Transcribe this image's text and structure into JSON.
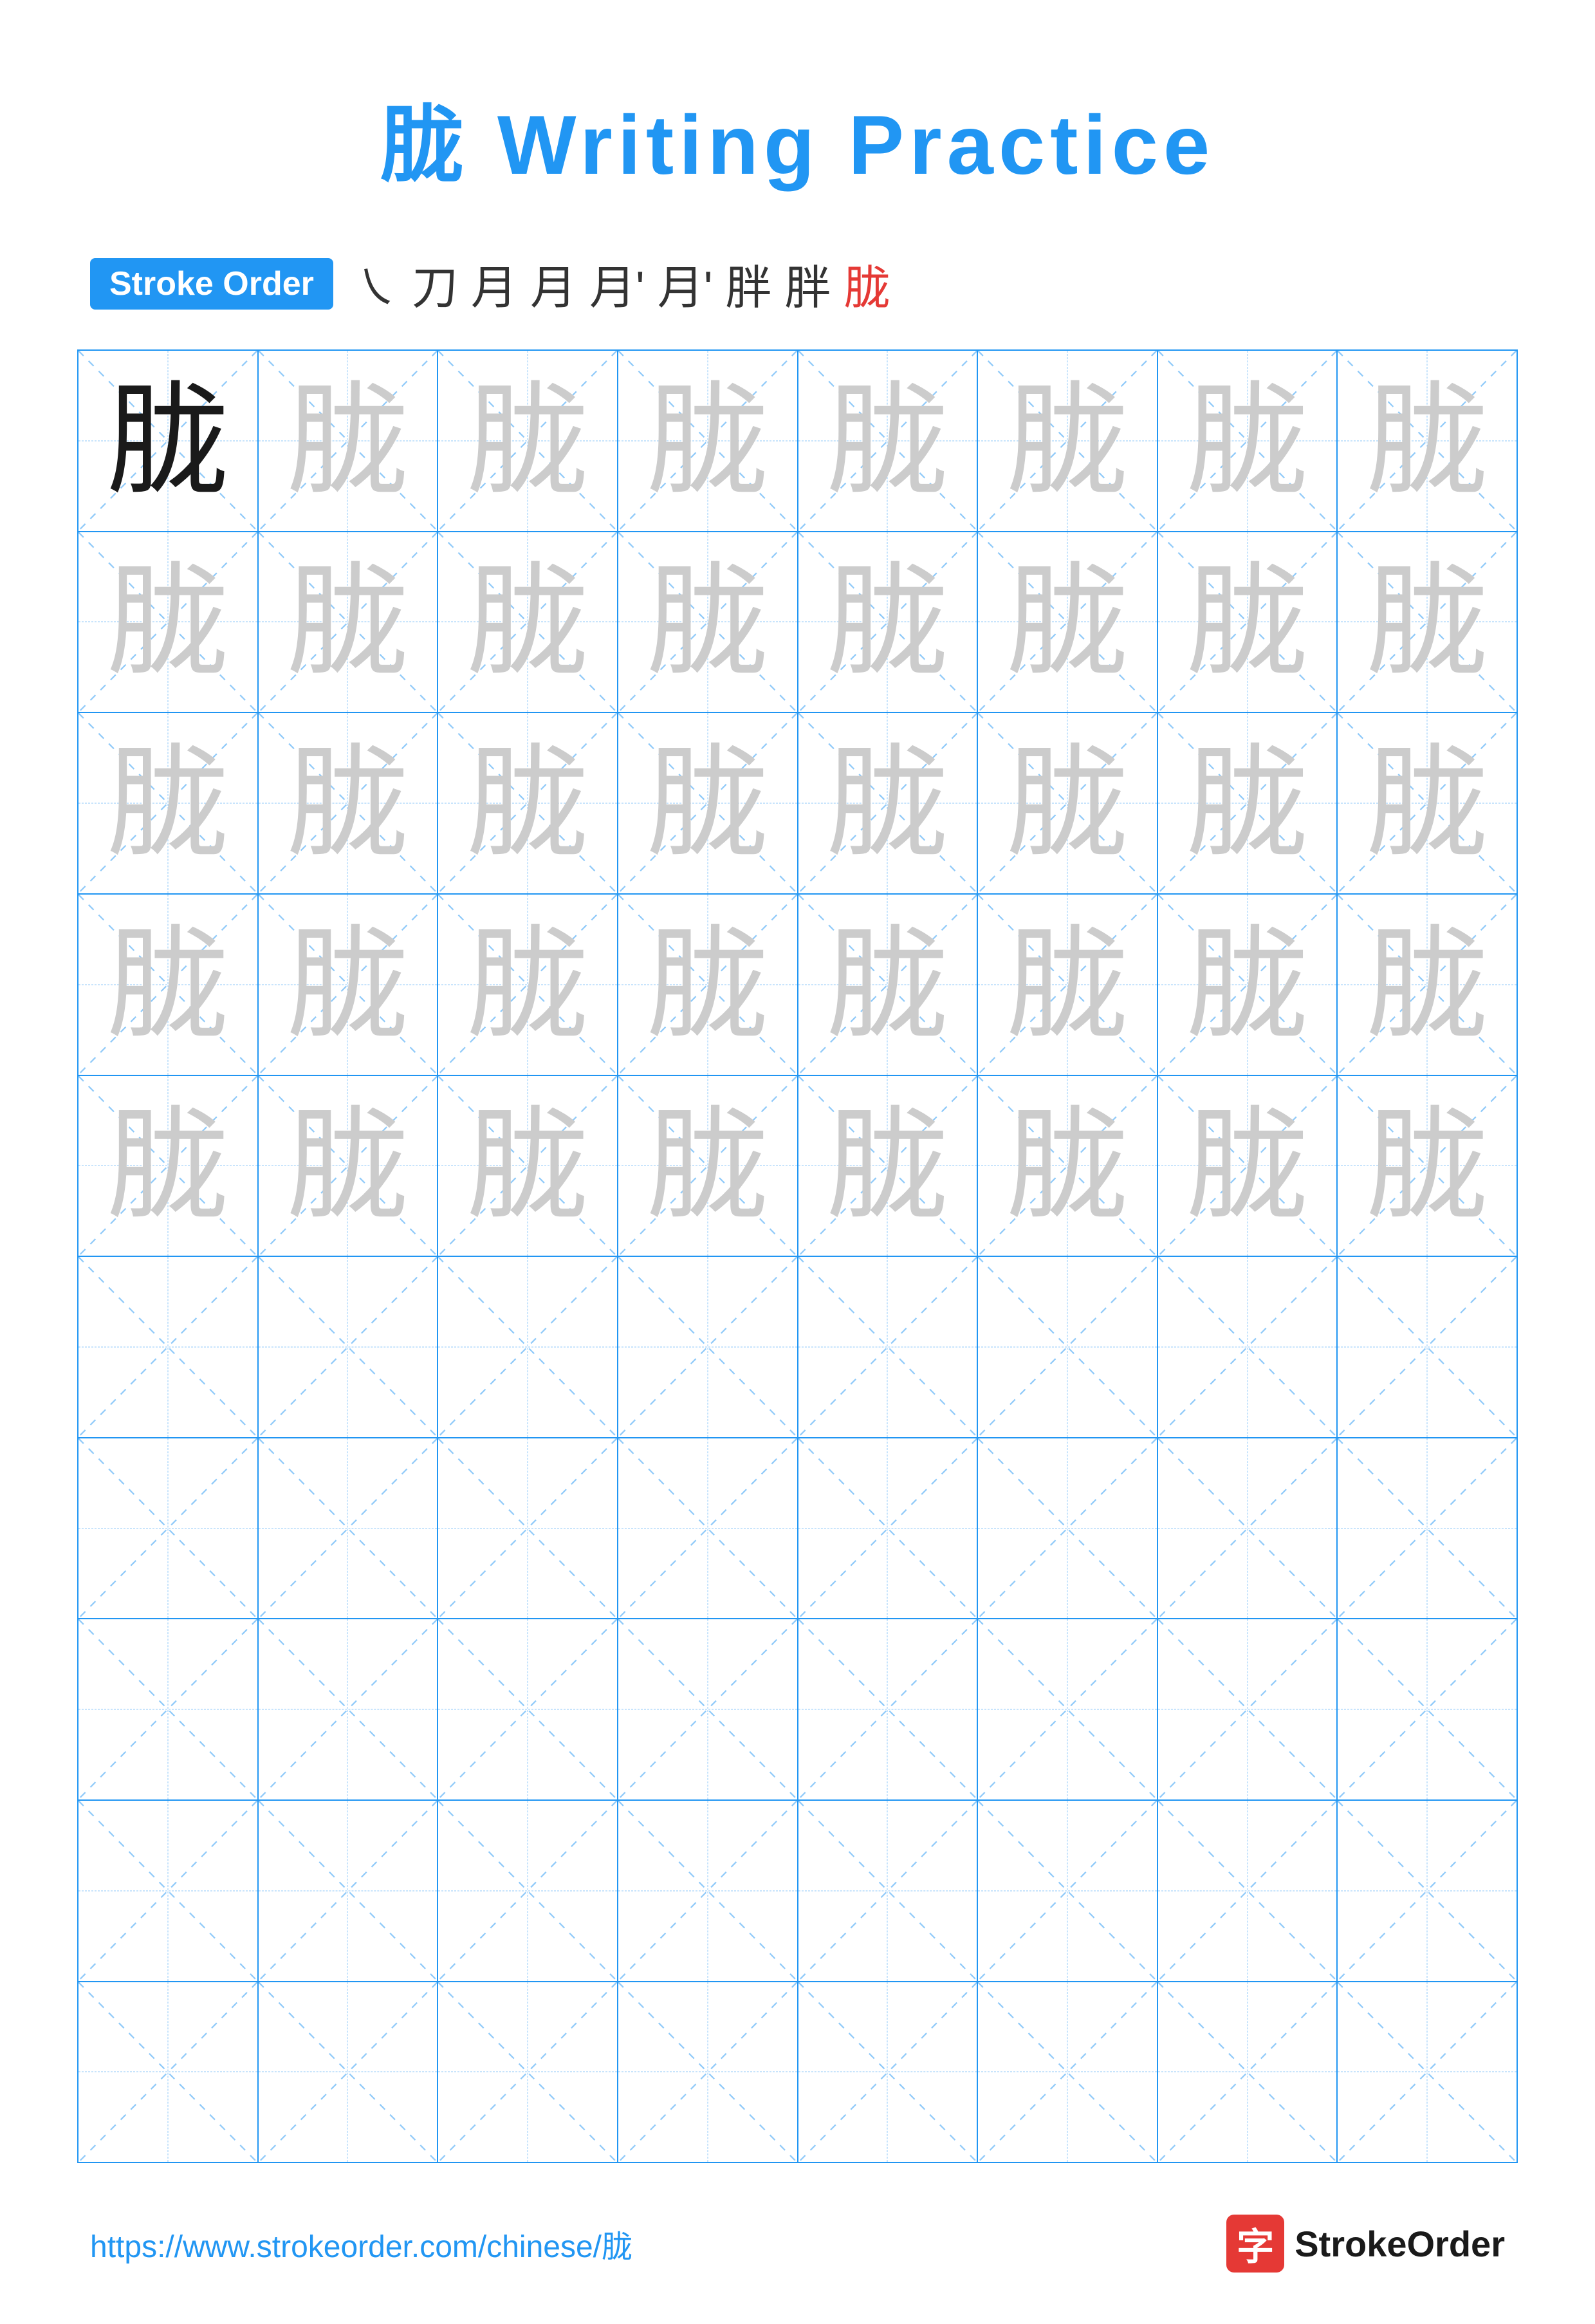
{
  "title": "胧 Writing Practice",
  "stroke_order_badge": "Stroke Order",
  "stroke_sequence": [
    "㇏",
    "刀",
    "月",
    "月",
    "月'",
    "月'",
    "胖",
    "胖",
    "胧"
  ],
  "stroke_sequence_last_red": true,
  "character": "胧",
  "rows": [
    {
      "type": "practice",
      "cells": [
        {
          "opacity": "dark"
        },
        {
          "opacity": "light"
        },
        {
          "opacity": "light"
        },
        {
          "opacity": "light"
        },
        {
          "opacity": "light"
        },
        {
          "opacity": "light"
        },
        {
          "opacity": "light"
        },
        {
          "opacity": "light"
        }
      ]
    },
    {
      "type": "practice",
      "cells": [
        {
          "opacity": "light"
        },
        {
          "opacity": "light"
        },
        {
          "opacity": "light"
        },
        {
          "opacity": "light"
        },
        {
          "opacity": "light"
        },
        {
          "opacity": "light"
        },
        {
          "opacity": "light"
        },
        {
          "opacity": "light"
        }
      ]
    },
    {
      "type": "practice",
      "cells": [
        {
          "opacity": "light"
        },
        {
          "opacity": "light"
        },
        {
          "opacity": "light"
        },
        {
          "opacity": "light"
        },
        {
          "opacity": "light"
        },
        {
          "opacity": "light"
        },
        {
          "opacity": "light"
        },
        {
          "opacity": "light"
        }
      ]
    },
    {
      "type": "practice",
      "cells": [
        {
          "opacity": "light"
        },
        {
          "opacity": "light"
        },
        {
          "opacity": "light"
        },
        {
          "opacity": "light"
        },
        {
          "opacity": "light"
        },
        {
          "opacity": "light"
        },
        {
          "opacity": "light"
        },
        {
          "opacity": "light"
        }
      ]
    },
    {
      "type": "practice",
      "cells": [
        {
          "opacity": "light"
        },
        {
          "opacity": "light"
        },
        {
          "opacity": "light"
        },
        {
          "opacity": "light"
        },
        {
          "opacity": "light"
        },
        {
          "opacity": "light"
        },
        {
          "opacity": "light"
        },
        {
          "opacity": "light"
        }
      ]
    },
    {
      "type": "empty"
    },
    {
      "type": "empty"
    },
    {
      "type": "empty"
    },
    {
      "type": "empty"
    },
    {
      "type": "empty"
    }
  ],
  "footer": {
    "url": "https://www.strokeorder.com/chinese/胧",
    "brand_name": "StrokeOrder",
    "brand_char": "字"
  }
}
